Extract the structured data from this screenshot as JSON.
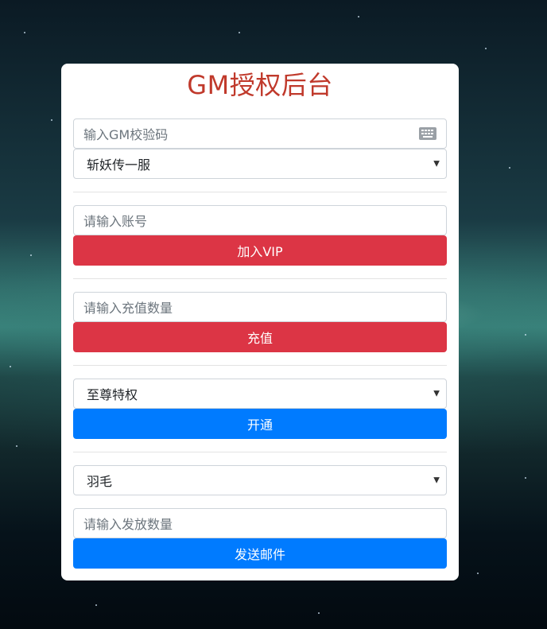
{
  "title": "GM授权后台",
  "gm_code": {
    "placeholder": "输入GM校验码",
    "icon": "keyboard-icon"
  },
  "server_select": {
    "selected": "斩妖传一服"
  },
  "vip": {
    "account_placeholder": "请输入账号",
    "button_label": "加入VIP"
  },
  "recharge": {
    "amount_placeholder": "请输入充值数量",
    "button_label": "充值"
  },
  "privilege": {
    "selected": "至尊特权",
    "button_label": "开通"
  },
  "mail": {
    "item_selected": "羽毛",
    "quantity_placeholder": "请输入发放数量",
    "button_label": "发送邮件"
  },
  "colors": {
    "title": "#c0392b",
    "danger": "#dc3545",
    "primary": "#007bff"
  }
}
